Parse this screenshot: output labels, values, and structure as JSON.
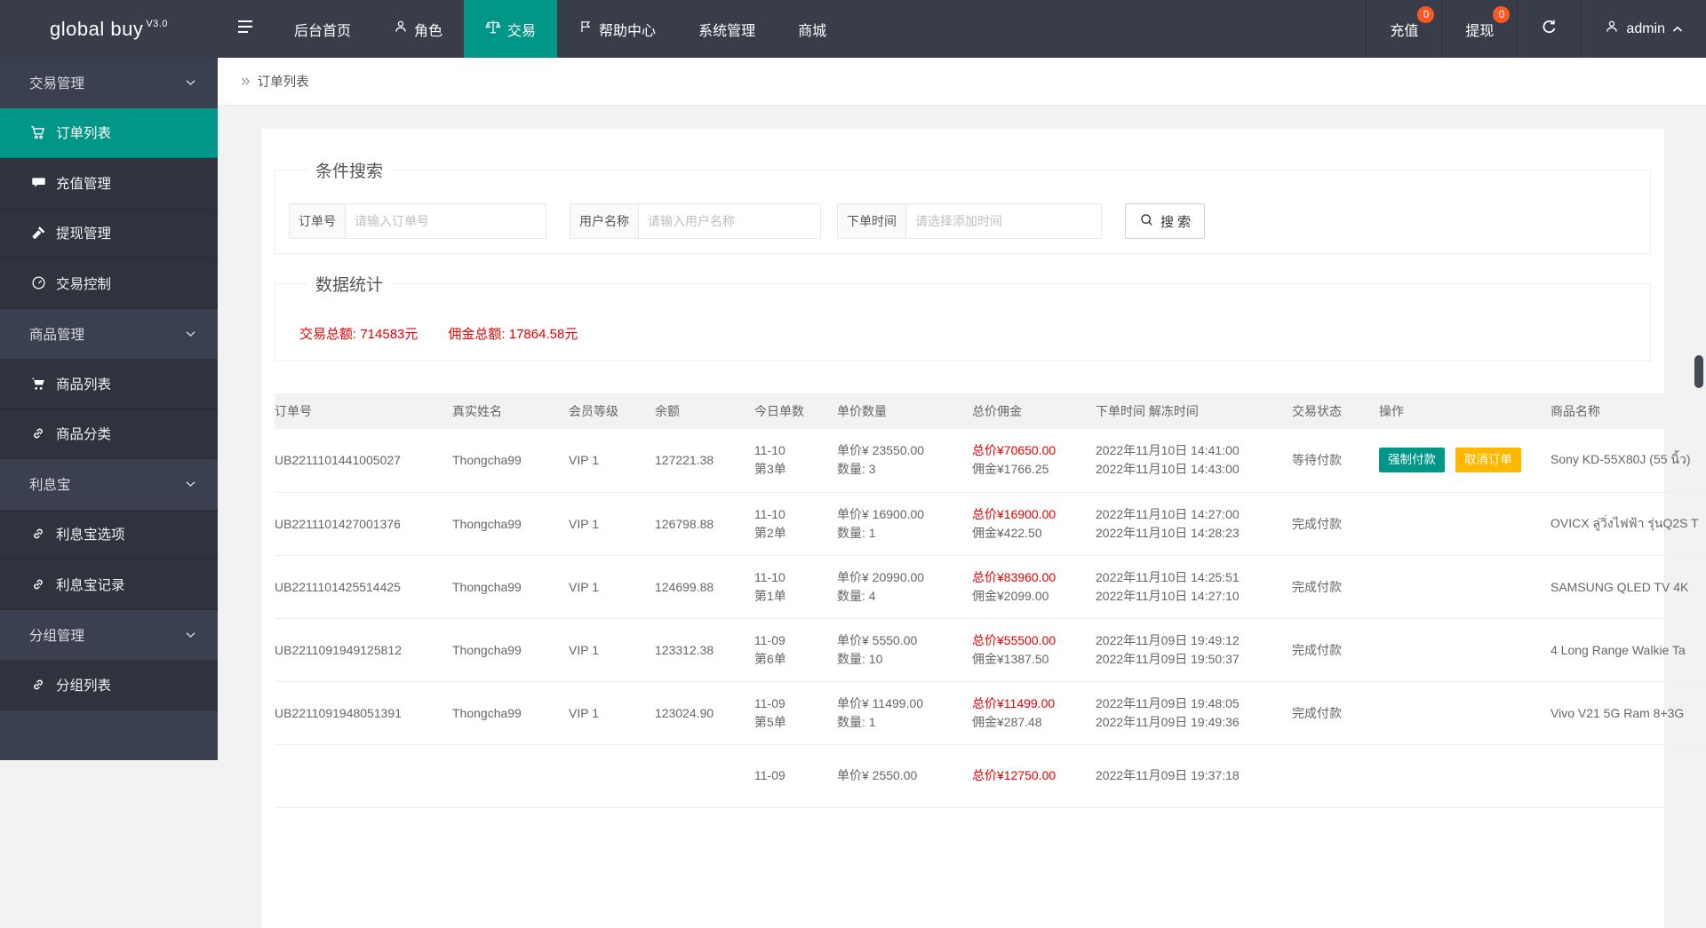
{
  "brand": {
    "name": "global buy",
    "version": "V3.0"
  },
  "colors": {
    "accent": "#009688",
    "red": "#e60000",
    "yellow": "#FFB800",
    "badge": "#FF5722",
    "topbar": "#393D49"
  },
  "topnav": {
    "items": [
      {
        "label": "后台首页",
        "icon": "none"
      },
      {
        "label": "角色",
        "icon": "person"
      },
      {
        "label": "交易",
        "icon": "scales",
        "active": true
      },
      {
        "label": "帮助中心",
        "icon": "flag"
      },
      {
        "label": "系统管理",
        "icon": "none"
      },
      {
        "label": "商城",
        "icon": "none"
      }
    ],
    "right": {
      "recharge": {
        "label": "充值",
        "badge": "0"
      },
      "withdraw": {
        "label": "提现",
        "badge": "0"
      },
      "user": {
        "name": "admin"
      }
    }
  },
  "sidebar": {
    "items": [
      {
        "label": "交易管理",
        "type": "group"
      },
      {
        "label": "订单列表",
        "type": "item",
        "icon": "cart",
        "active": true
      },
      {
        "label": "充值管理",
        "type": "item",
        "icon": "comment"
      },
      {
        "label": "提现管理",
        "type": "item",
        "icon": "gavel"
      },
      {
        "label": "交易控制",
        "type": "item",
        "icon": "gauge"
      },
      {
        "label": "商品管理",
        "type": "group"
      },
      {
        "label": "商品列表",
        "type": "item",
        "icon": "cart"
      },
      {
        "label": "商品分类",
        "type": "item",
        "icon": "link"
      },
      {
        "label": "利息宝",
        "type": "group"
      },
      {
        "label": "利息宝选项",
        "type": "item",
        "icon": "link"
      },
      {
        "label": "利息宝记录",
        "type": "item",
        "icon": "link"
      },
      {
        "label": "分组管理",
        "type": "group"
      },
      {
        "label": "分组列表",
        "type": "item",
        "icon": "link"
      }
    ]
  },
  "breadcrumb": {
    "arrow": "»",
    "current": "订单列表"
  },
  "search": {
    "legend": "条件搜索",
    "fields": [
      {
        "label": "订单号",
        "placeholder": "请输入订单号"
      },
      {
        "label": "用户名称",
        "placeholder": "请输入用户名称"
      },
      {
        "label": "下单时间",
        "placeholder": "请选择添加时间"
      }
    ],
    "button_label": "搜 索"
  },
  "stats": {
    "legend": "数据统计",
    "total_label": "交易总额:",
    "total_value": "714583元",
    "commission_label": "佣金总额:",
    "commission_value": "17864.58元"
  },
  "table": {
    "headers": [
      "订单号",
      "真实姓名",
      "会员等级",
      "余额",
      "今日单数",
      "单价数量",
      "总价佣金",
      "下单时间 解冻时间",
      "交易状态",
      "操作",
      "商品名称"
    ],
    "rows": [
      {
        "order_no": "UB2211101441005027",
        "real_name": "Thongcha99",
        "vip_level": "VIP 1",
        "balance": "127221.38",
        "date": "11-10",
        "seq": "第3单",
        "unit_price": "单价¥ 23550.00",
        "quantity": "数量: 3",
        "total_price": "总价¥70650.00",
        "commission": "佣金¥1766.25",
        "order_time": "2022年11月10日 14:41:00",
        "unfreeze_time": "2022年11月10日 14:43:00",
        "status": "等待付款",
        "actions": [
          "强制付款",
          "取消订单"
        ],
        "product": "Sony KD-55X80J (55 นิ้ว)"
      },
      {
        "order_no": "UB2211101427001376",
        "real_name": "Thongcha99",
        "vip_level": "VIP 1",
        "balance": "126798.88",
        "date": "11-10",
        "seq": "第2单",
        "unit_price": "单价¥ 16900.00",
        "quantity": "数量: 1",
        "total_price": "总价¥16900.00",
        "commission": "佣金¥422.50",
        "order_time": "2022年11月10日 14:27:00",
        "unfreeze_time": "2022年11月10日 14:28:23",
        "status": "完成付款",
        "actions": [],
        "product": "OVICX ลู่วิ่งไฟฟ้า รุ่นQ2S T"
      },
      {
        "order_no": "UB2211101425514425",
        "real_name": "Thongcha99",
        "vip_level": "VIP 1",
        "balance": "124699.88",
        "date": "11-10",
        "seq": "第1单",
        "unit_price": "单价¥ 20990.00",
        "quantity": "数量: 4",
        "total_price": "总价¥83960.00",
        "commission": "佣金¥2099.00",
        "order_time": "2022年11月10日 14:25:51",
        "unfreeze_time": "2022年11月10日 14:27:10",
        "status": "完成付款",
        "actions": [],
        "product": "SAMSUNG QLED TV 4K"
      },
      {
        "order_no": "UB2211091949125812",
        "real_name": "Thongcha99",
        "vip_level": "VIP 1",
        "balance": "123312.38",
        "date": "11-09",
        "seq": "第6单",
        "unit_price": "单价¥ 5550.00",
        "quantity": "数量: 10",
        "total_price": "总价¥55500.00",
        "commission": "佣金¥1387.50",
        "order_time": "2022年11月09日 19:49:12",
        "unfreeze_time": "2022年11月09日 19:50:37",
        "status": "完成付款",
        "actions": [],
        "product": "4 Long Range Walkie Ta"
      },
      {
        "order_no": "UB2211091948051391",
        "real_name": "Thongcha99",
        "vip_level": "VIP 1",
        "balance": "123024.90",
        "date": "11-09",
        "seq": "第5单",
        "unit_price": "单价¥ 11499.00",
        "quantity": "数量: 1",
        "total_price": "总价¥11499.00",
        "commission": "佣金¥287.48",
        "order_time": "2022年11月09日 19:48:05",
        "unfreeze_time": "2022年11月09日 19:49:36",
        "status": "完成付款",
        "actions": [],
        "product": "Vivo V21 5G Ram 8+3G"
      },
      {
        "order_no": "",
        "real_name": "",
        "vip_level": "",
        "balance": "",
        "date": "11-09",
        "seq": "",
        "unit_price": "单价¥ 2550.00",
        "quantity": "",
        "total_price": "总价¥12750.00",
        "commission": "",
        "order_time": "2022年11月09日 19:37:18",
        "unfreeze_time": "",
        "status": "",
        "actions": [],
        "product": ""
      }
    ]
  }
}
